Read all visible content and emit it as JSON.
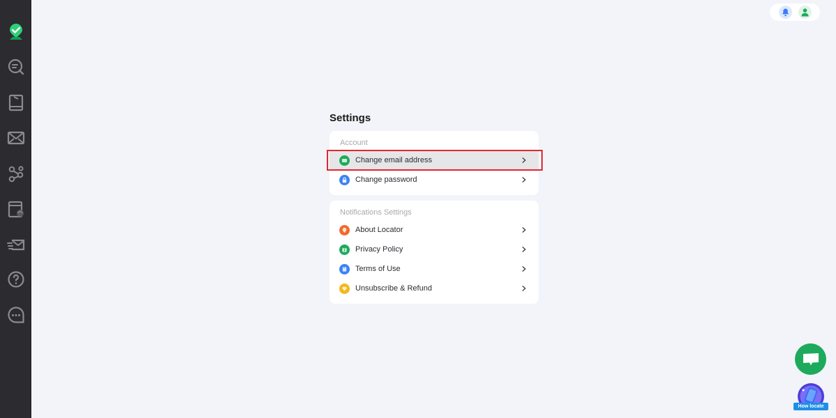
{
  "sidebar": {
    "items": [
      {
        "name": "locator-logo",
        "icon": "location-check-icon",
        "color": "#1eaa5c"
      },
      {
        "name": "search",
        "icon": "search-chat-icon"
      },
      {
        "name": "book",
        "icon": "book-icon"
      },
      {
        "name": "mail",
        "icon": "mail-icon"
      },
      {
        "name": "share",
        "icon": "share-icon"
      },
      {
        "name": "calendar",
        "icon": "calendar-refresh-icon"
      },
      {
        "name": "send-mail",
        "icon": "send-mail-icon"
      },
      {
        "name": "help",
        "icon": "help-icon"
      },
      {
        "name": "chat",
        "icon": "chat-bubble-icon"
      }
    ]
  },
  "topbar": {
    "notification_icon": "bell-icon",
    "profile_icon": "user-icon"
  },
  "settings": {
    "title": "Settings",
    "sections": [
      {
        "label": "Account",
        "items": [
          {
            "label": "Change email address",
            "icon": "email-icon",
            "color": "#1eaa5c",
            "selected": true
          },
          {
            "label": "Change password",
            "icon": "lock-icon",
            "color": "#3b82f6",
            "selected": false
          }
        ]
      },
      {
        "label": "Notifications Settings",
        "items": [
          {
            "label": "About Locator",
            "icon": "location-pin-icon",
            "color": "#f26a2e"
          },
          {
            "label": "Privacy Policy",
            "icon": "shield-book-icon",
            "color": "#1eaa5c"
          },
          {
            "label": "Terms of Use",
            "icon": "document-icon",
            "color": "#3b82f6"
          },
          {
            "label": "Unsubscribe & Refund",
            "icon": "diamond-icon",
            "color": "#f2b91c"
          }
        ]
      }
    ]
  },
  "floating": {
    "chat_icon": "chat-support-icon",
    "how_locate_label": "How locate"
  },
  "colors": {
    "accent": "#1eaa5c",
    "highlight_border": "#e0282e",
    "sidebar_bg": "#2b2b30",
    "page_bg": "#f3f4f9"
  }
}
